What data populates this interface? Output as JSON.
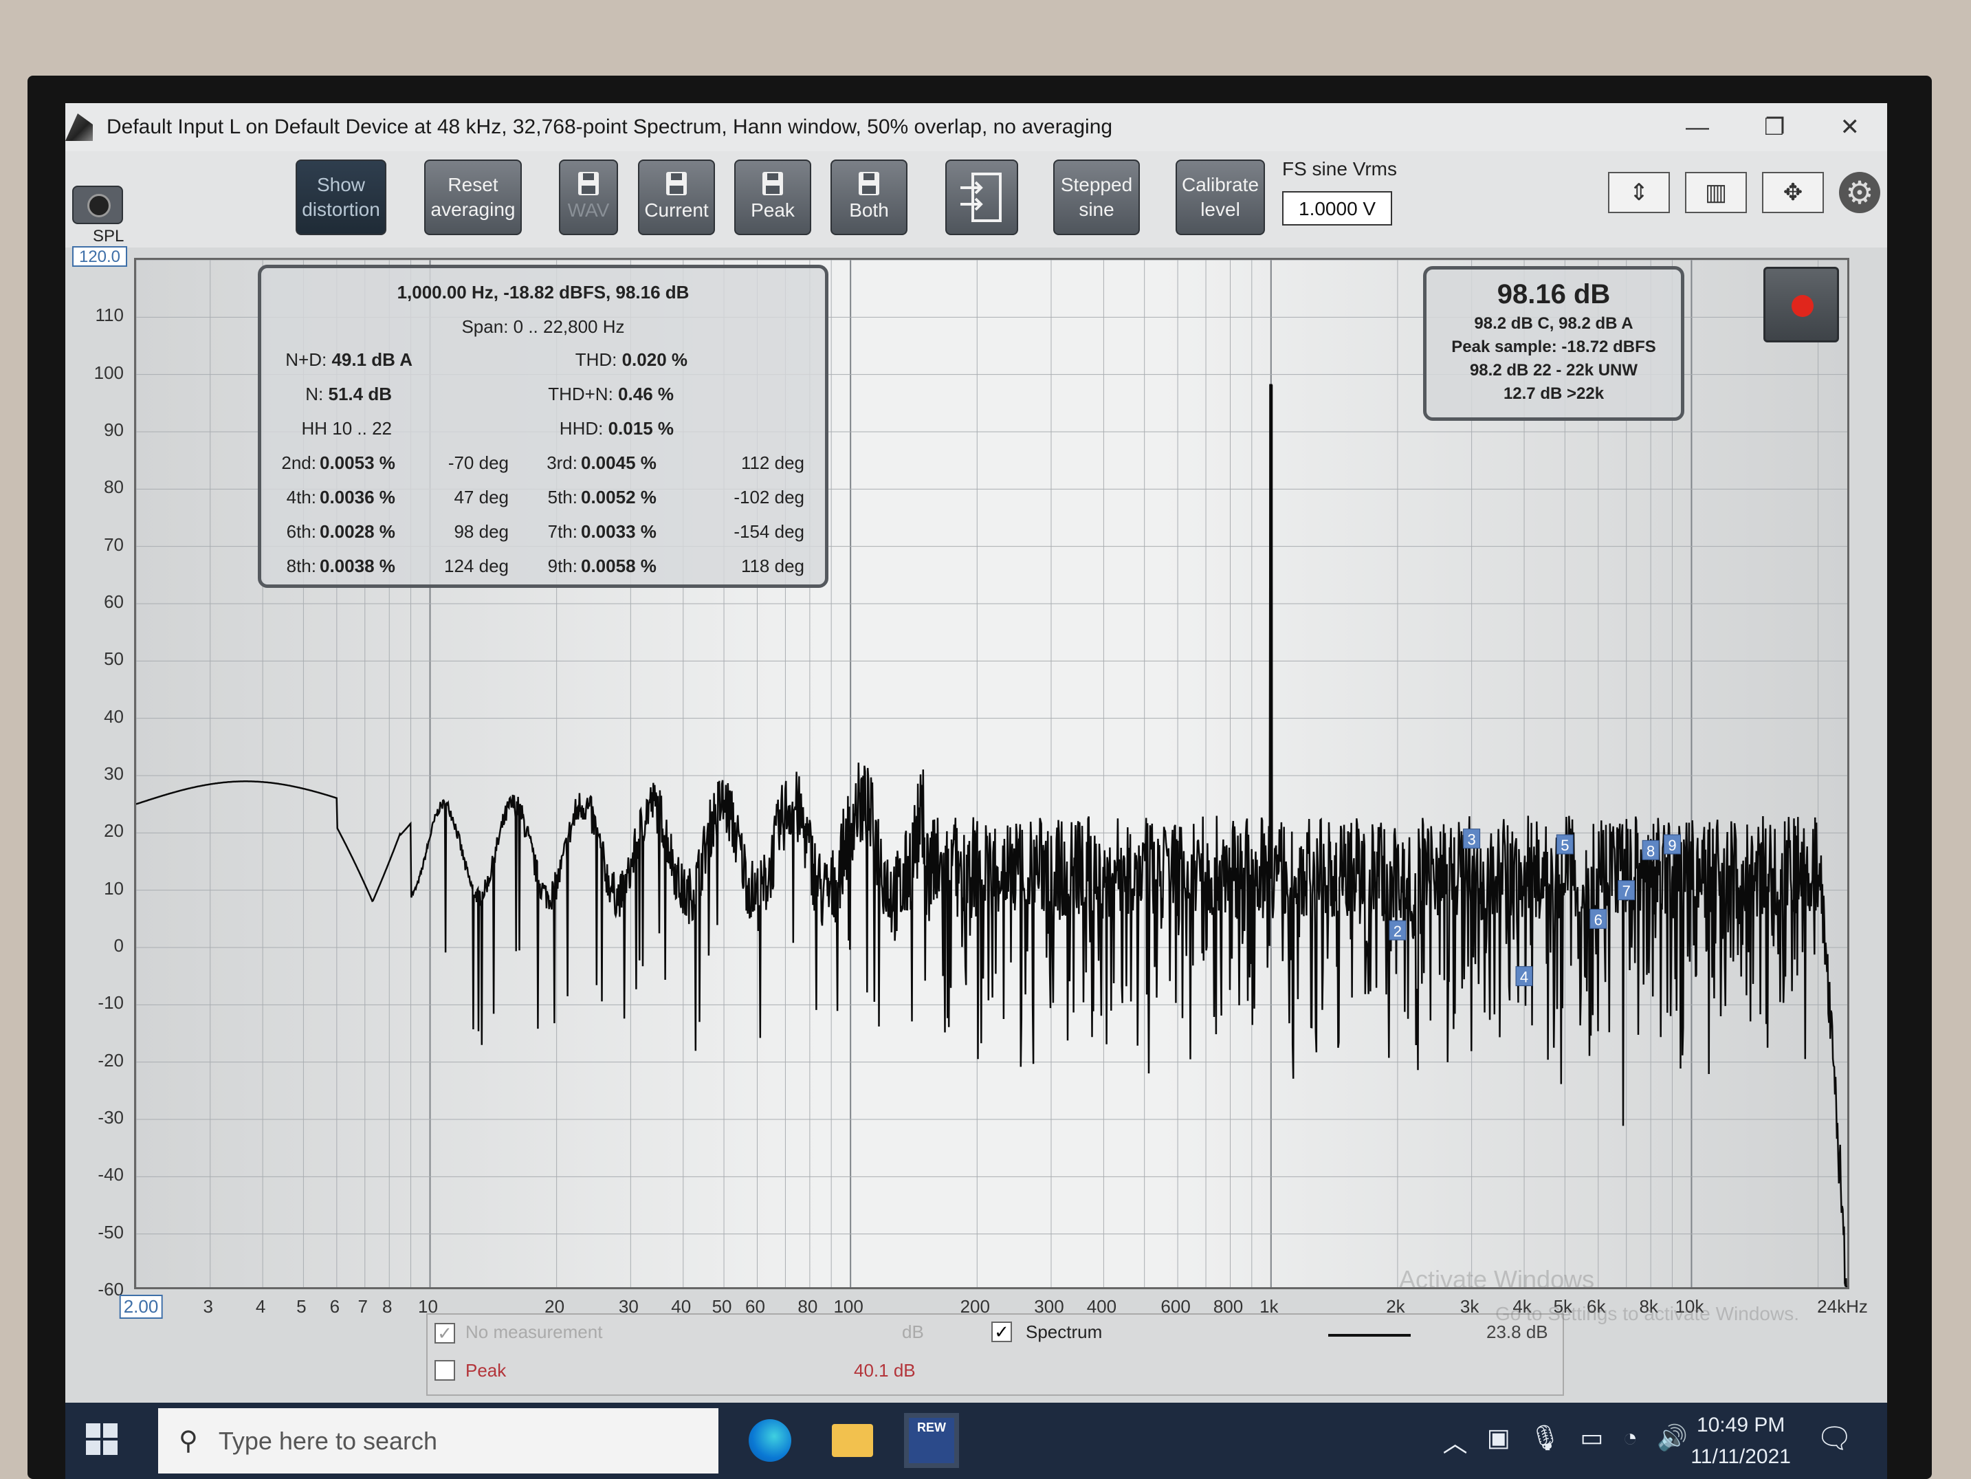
{
  "window": {
    "title": "Default Input L on Default Device at 48 kHz, 32,768-point Spectrum, Hann window, 50% overlap, no averaging",
    "minimize": "—",
    "restore": "❐",
    "close": "✕"
  },
  "toolbar": {
    "show_distortion": [
      "Show",
      "distortion"
    ],
    "reset_averaging": [
      "Reset",
      "averaging"
    ],
    "wav": "WAV",
    "current": "Current",
    "peak": "Peak",
    "both": "Both",
    "stepped_sine": [
      "Stepped",
      "sine"
    ],
    "calibrate_level": [
      "Calibrate",
      "level"
    ],
    "fs_label": "FS sine Vrms",
    "fs_value": "1.0000 V"
  },
  "graph": {
    "y_unit": "SPL",
    "y_top": "120.0",
    "y_ticks": [
      "110",
      "100",
      "90",
      "80",
      "70",
      "60",
      "50",
      "40",
      "30",
      "20",
      "10",
      "0",
      "-10",
      "-20",
      "-30",
      "-40",
      "-50",
      "-60"
    ],
    "x_first": "2.00",
    "x_ticks": [
      "3",
      "4",
      "5",
      "6",
      "7",
      "8",
      "10",
      "20",
      "30",
      "40",
      "50",
      "60",
      "80",
      "100",
      "200",
      "300",
      "400",
      "600",
      "800",
      "1k",
      "2k",
      "3k",
      "4k",
      "5k",
      "6k",
      "8k",
      "10k",
      "24kHz"
    ],
    "harmonic_markers": [
      "2",
      "3",
      "4",
      "5",
      "6",
      "7",
      "8",
      "9"
    ]
  },
  "distortion": {
    "header": "1,000.00 Hz, -18.82 dBFS, 98.16 dB",
    "span": "Span: 0 .. 22,800 Hz",
    "nd_label": "N+D:",
    "nd_value": "49.1 dB A",
    "thd_label": "THD:",
    "thd_value": "0.020 %",
    "n_label": "N:",
    "n_value": "51.4 dB",
    "thdn_label": "THD+N:",
    "thdn_value": "0.46 %",
    "hh": "HH 10 .. 22",
    "hhd_label": "HHD:",
    "hhd_value": "0.015 %",
    "harmonics": [
      {
        "l1": "2nd:",
        "v1": "0.0053 %",
        "p1": "-70 deg",
        "l2": "3rd:",
        "v2": "0.0045 %",
        "p2": "112 deg"
      },
      {
        "l1": "4th:",
        "v1": "0.0036 %",
        "p1": "47 deg",
        "l2": "5th:",
        "v2": "0.0052 %",
        "p2": "-102 deg"
      },
      {
        "l1": "6th:",
        "v1": "0.0028 %",
        "p1": "98 deg",
        "l2": "7th:",
        "v2": "0.0033 %",
        "p2": "-154 deg"
      },
      {
        "l1": "8th:",
        "v1": "0.0038 %",
        "p1": "124 deg",
        "l2": "9th:",
        "v2": "0.0058 %",
        "p2": "118 deg"
      }
    ]
  },
  "spl_meter": {
    "big": "98.16 dB",
    "line1": "98.2 dB C, 98.2 dB A",
    "line2": "Peak sample: -18.72 dBFS",
    "line3": "98.2 dB 22 - 22k UNW",
    "line4": "12.7 dB >22k"
  },
  "legend": {
    "row1_label": "No measurement",
    "row1_value": "dB",
    "row2_label": "Peak",
    "row2_value": "40.1 dB",
    "spectrum_label": "Spectrum",
    "spectrum_value": "23.8 dB"
  },
  "watermark": {
    "line1": "Activate Windows",
    "line2": "Go to Settings to activate Windows."
  },
  "taskbar": {
    "search_placeholder": "Type here to search",
    "rew_label": "REW",
    "time": "10:49 PM",
    "date": "11/11/2021"
  },
  "colors": {
    "accent": "#3e6fa8",
    "record": "#e0261c",
    "taskbar": "#1d2a3f"
  }
}
